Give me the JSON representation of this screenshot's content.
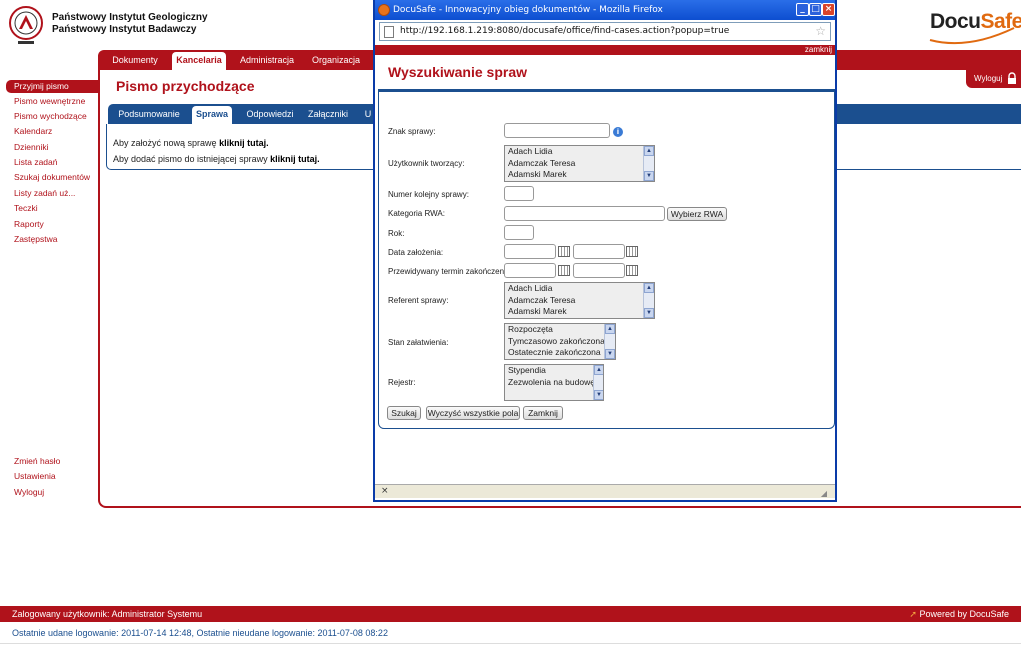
{
  "institute": {
    "line1": "Państwowy Instytut Geologiczny",
    "line2": "Państwowy Instytut Badawczy"
  },
  "brand": {
    "docu": "Docu",
    "safe": "Safe",
    "accent": "#b0121b",
    "blue": "#1b4f8f",
    "orange": "#e06a10"
  },
  "main_nav": {
    "tabs": [
      {
        "label": "Dokumenty"
      },
      {
        "label": "Kancelaria"
      },
      {
        "label": "Administracja"
      },
      {
        "label": "Organizacja"
      }
    ],
    "logout": "Wyloguj"
  },
  "page_title": "Pismo przychodzące",
  "sub_nav": {
    "tabs": [
      {
        "label": "Podsumowanie"
      },
      {
        "label": "Sprawa"
      },
      {
        "label": "Odpowiedzi"
      },
      {
        "label": "Załączniki"
      },
      {
        "label": "U"
      }
    ]
  },
  "messages": [
    {
      "text": "Aby założyć nową sprawę ",
      "link": "kliknij tutaj."
    },
    {
      "text": "Aby dodać pismo do istniejącej sprawy ",
      "link": "kliknij tutaj."
    }
  ],
  "sidebar": {
    "items": [
      {
        "label": "Przyjmij pismo"
      },
      {
        "label": "Pismo wewnętrzne"
      },
      {
        "label": "Pismo wychodzące"
      },
      {
        "label": "Kalendarz"
      },
      {
        "label": "Dzienniki"
      },
      {
        "label": "Lista zadań"
      },
      {
        "label": "Szukaj dokumentów"
      },
      {
        "label": "Listy zadań uż..."
      },
      {
        "label": "Teczki"
      },
      {
        "label": "Raporty"
      },
      {
        "label": "Zastępstwa"
      }
    ],
    "bottom": [
      {
        "label": "Zmień hasło"
      },
      {
        "label": "Ustawienia"
      },
      {
        "label": "Wyloguj"
      }
    ]
  },
  "footer": {
    "user": "Zalogowany użytkownik: Administrator Systemu",
    "powered": "Powered by DocuSafe",
    "logins": "Ostatnie udane logowanie: 2011-07-14 12:48, Ostatnie nieudane logowanie: 2011-07-08 08:22"
  },
  "popup": {
    "window_title": "DocuSafe - Innowacyjny obieg dokumentów - Mozilla Firefox",
    "url": "http://192.168.1.219:8080/docusafe/office/find-cases.action?popup=true",
    "close_link": "zamknij",
    "heading": "Wyszukiwanie spraw",
    "labels": {
      "znak": "Znak sprawy:",
      "uzytkownik": "Użytkownik tworzący:",
      "numer": "Numer kolejny sprawy:",
      "kategoria": "Kategoria RWA:",
      "rok": "Rok:",
      "data": "Data założenia:",
      "termin": "Przewidywany termin zakończenia:",
      "referent": "Referent sprawy:",
      "stan": "Stan załatwienia:",
      "rejestr": "Rejestr:"
    },
    "users": [
      "Adach Lidia",
      "Adamczak Teresa",
      "Adamski Marek"
    ],
    "referents": [
      "Adach Lidia",
      "Adamczak Teresa",
      "Adamski Marek"
    ],
    "states": [
      "Rozpoczęta",
      "Tymczasowo zakończona",
      "Ostatecznie zakończona"
    ],
    "registers": [
      "Stypendia",
      "Zezwolenia na budowę"
    ],
    "buttons": {
      "rwa": "Wybierz RWA",
      "search": "Szukaj",
      "clear": "Wyczyść wszystkie pola",
      "close": "Zamknij"
    },
    "status_close": "×"
  }
}
